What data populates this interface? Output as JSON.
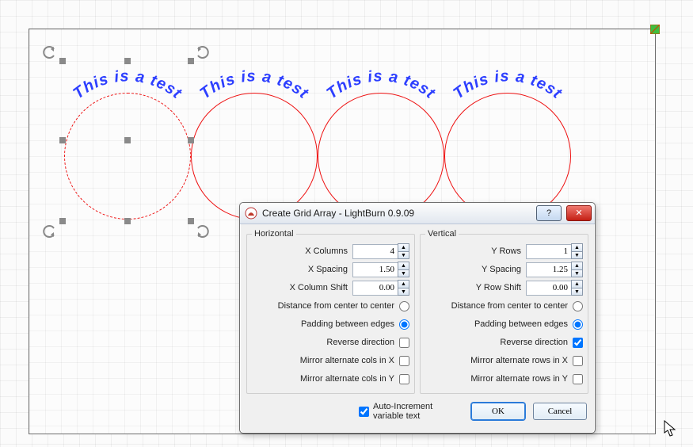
{
  "dialog": {
    "title": "Create Grid Array - LightBurn 0.9.09",
    "horizontal": {
      "legend": "Horizontal",
      "x_columns": {
        "label": "X Columns",
        "value": "4"
      },
      "x_spacing": {
        "label": "X Spacing",
        "value": "1.50"
      },
      "x_column_shift": {
        "label": "X Column Shift",
        "value": "0.00"
      },
      "distance_center": "Distance from center to center",
      "padding_edges": "Padding between edges",
      "reverse_direction": "Reverse direction",
      "mirror_x": "Mirror alternate cols in X",
      "mirror_y": "Mirror alternate cols in Y"
    },
    "vertical": {
      "legend": "Vertical",
      "y_rows": {
        "label": "Y Rows",
        "value": "1"
      },
      "y_spacing": {
        "label": "Y Spacing",
        "value": "1.25"
      },
      "y_row_shift": {
        "label": "Y Row Shift",
        "value": "0.00"
      },
      "distance_center": "Distance from center to center",
      "padding_edges": "Padding between edges",
      "reverse_direction": "Reverse direction",
      "mirror_x": "Mirror alternate rows in X",
      "mirror_y": "Mirror alternate rows in Y"
    },
    "auto_increment": "Auto-Increment variable text",
    "buttons": {
      "ok": "OK",
      "cancel": "Cancel"
    },
    "controls": {
      "h_spacing_radio": "padding",
      "v_spacing_radio": "padding",
      "h_reverse": false,
      "v_reverse": true,
      "h_mirror_x": false,
      "h_mirror_y": false,
      "v_mirror_x": false,
      "v_mirror_y": false,
      "auto_inc": true
    }
  },
  "canvas_text": "This is a test"
}
